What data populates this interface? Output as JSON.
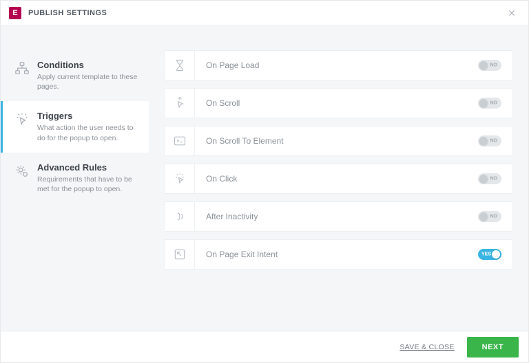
{
  "header": {
    "logo_glyph": "E",
    "title": "PUBLISH SETTINGS"
  },
  "sidebar": {
    "items": [
      {
        "id": "conditions",
        "title": "Conditions",
        "desc": "Apply current template to these pages.",
        "active": false
      },
      {
        "id": "triggers",
        "title": "Triggers",
        "desc": "What action the user needs to do for the popup to open.",
        "active": true
      },
      {
        "id": "advanced",
        "title": "Advanced Rules",
        "desc": "Requirements that have to be met for the popup to open.",
        "active": false
      }
    ]
  },
  "triggers": [
    {
      "id": "page_load",
      "label": "On Page Load",
      "enabled": false
    },
    {
      "id": "scroll",
      "label": "On Scroll",
      "enabled": false
    },
    {
      "id": "scroll_elem",
      "label": "On Scroll To Element",
      "enabled": false
    },
    {
      "id": "click",
      "label": "On Click",
      "enabled": false
    },
    {
      "id": "inactivity",
      "label": "After Inactivity",
      "enabled": false
    },
    {
      "id": "exit_intent",
      "label": "On Page Exit Intent",
      "enabled": true
    }
  ],
  "toggle_labels": {
    "on": "YES",
    "off": "NO"
  },
  "footer": {
    "save_close": "SAVE & CLOSE",
    "next": "NEXT"
  }
}
